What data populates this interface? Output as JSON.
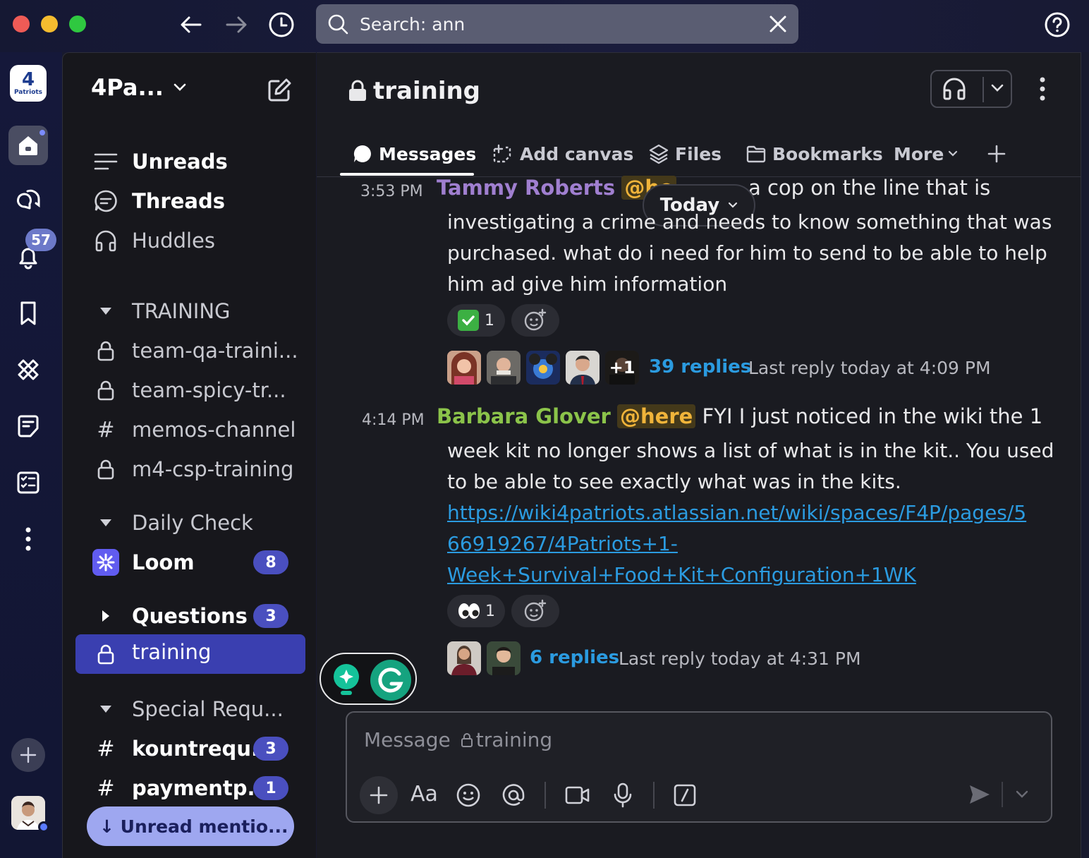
{
  "titlebar": {
    "search_text": "Search: ann",
    "icons": [
      "back-arrow-icon",
      "forward-arrow-icon",
      "history-clock-icon",
      "search-icon",
      "close-icon",
      "help-icon"
    ]
  },
  "rail": {
    "workspace_logo_text": "Patriots",
    "activity_badge": "57"
  },
  "sidebar": {
    "workspace_name": "4Pa...",
    "nav": [
      {
        "label": "Unreads"
      },
      {
        "label": "Threads"
      },
      {
        "label": "Huddles"
      }
    ],
    "sections": {
      "training_header": "TRAINING",
      "training_channels": [
        "team-qa-traini...",
        "team-spicy-tr...",
        "memos-channel",
        "m4-csp-training"
      ],
      "daily_header": "Daily Check",
      "loom_label": "Loom",
      "loom_badge": "8",
      "questions_label": "Questions",
      "questions_badge": "3",
      "active_channel": "training",
      "special_header": "Special Requ...",
      "kount_label": "kountrequ...",
      "kount_badge": "3",
      "payment_label": "paymentp...",
      "payment_badge": "1"
    },
    "unread_mentions_button": "↓ Unread mentio..."
  },
  "channel": {
    "name": "training",
    "tabs": [
      "Messages",
      "Add canvas",
      "Files",
      "Bookmarks",
      "More"
    ],
    "date_divider": "Today"
  },
  "messages": [
    {
      "time": "3:53 PM",
      "author": "Tammy Roberts",
      "mention": "@he",
      "first_line_tail": "a cop on the line that is",
      "body_lines": [
        "investigating a crime and needs to know something that was",
        "purchased. what do i need for him to send to be able to help",
        "him ad give him information"
      ],
      "reaction_count": "1",
      "reply_count": "39 replies",
      "last_reply": "Last reply today at 4:09 PM",
      "extra_avatars": "+1"
    },
    {
      "time": "4:14 PM",
      "author": "Barbara Glover",
      "mention": "@here",
      "first_line_tail": "FYI I just noticed in the wiki the 1",
      "body_lines": [
        "week kit no longer shows a list of what is in the kit.. You used",
        "to be able to see exactly what was in the kits."
      ],
      "link_lines": [
        "https://wiki4patriots.atlassian.net/wiki/spaces/F4P/pages/5",
        "66919267/4Patriots+1-",
        "Week+Survival+Food+Kit+Configuration+1WK"
      ],
      "reaction_count": "1",
      "reply_count": "6 replies",
      "last_reply": "Last reply today at 4:31 PM"
    }
  ],
  "composer": {
    "placeholder_prefix": "Message",
    "placeholder_channel": "training",
    "format_label": "Aa"
  },
  "colors": {
    "accent": "#4a4fbf",
    "active_row": "#3a3fb0",
    "link": "#2b9be0",
    "mention": "#f0b43a",
    "author_tammy": "#a07fd0",
    "author_barbara": "#8bc34a"
  }
}
